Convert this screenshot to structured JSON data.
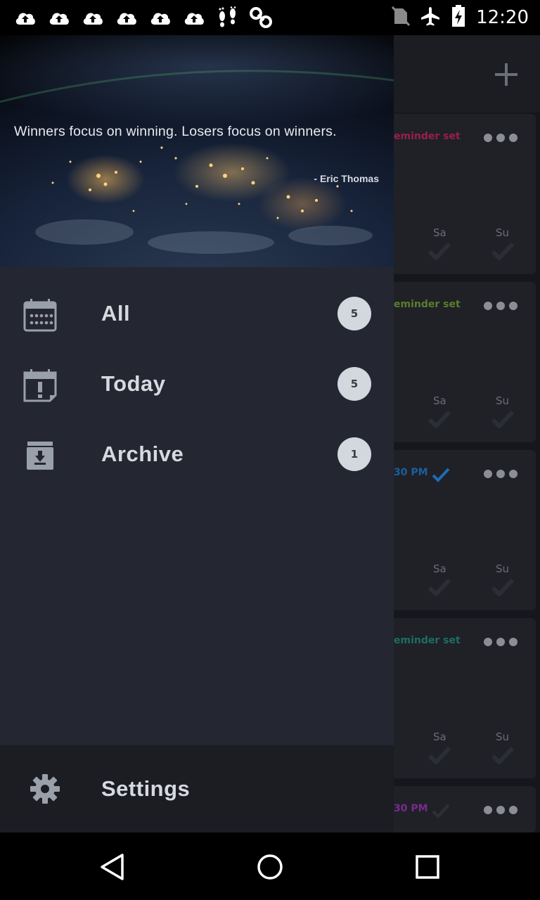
{
  "status_bar": {
    "time": "12:20",
    "left_icons": [
      "upload-cloud-icon",
      "upload-cloud-icon",
      "upload-cloud-icon",
      "upload-cloud-icon",
      "upload-cloud-icon",
      "upload-cloud-icon",
      "footprints-icon",
      "link-icon"
    ],
    "right_icons": [
      "no-sim-icon",
      "airplane-mode-icon",
      "battery-charging-icon"
    ]
  },
  "drawer": {
    "quote": "Winners focus on winning. Losers focus on winners.",
    "author": "- Eric Thomas",
    "items": [
      {
        "label": "All",
        "count": "5",
        "icon": "calendar-icon"
      },
      {
        "label": "Today",
        "count": "5",
        "icon": "calendar-alert-icon"
      },
      {
        "label": "Archive",
        "count": "1",
        "icon": "archive-icon"
      }
    ],
    "settings_label": "Settings"
  },
  "background": {
    "cards": [
      {
        "reminder": "eminder set",
        "reminder_color": "#c2185b",
        "days": [
          "Sa",
          "Su"
        ]
      },
      {
        "reminder": "eminder set",
        "reminder_color": "#7cb342",
        "days": [
          "Sa",
          "Su"
        ]
      },
      {
        "reminder": "30 PM",
        "reminder_color": "#1e88e5",
        "days": [
          "Sa",
          "Su"
        ]
      },
      {
        "reminder": "eminder set",
        "reminder_color": "#00897b",
        "days": [
          "Sa",
          "Su"
        ]
      },
      {
        "reminder": "30 PM",
        "reminder_color": "#8e24aa",
        "days": []
      }
    ]
  },
  "colors": {
    "drawer_bg": "#242731",
    "settings_bg": "#1b1d23",
    "badge_bg": "#d3d7de",
    "text": "#d6d9df"
  },
  "navigation_bar": {
    "buttons": [
      "back-icon",
      "home-icon",
      "recents-icon"
    ]
  }
}
